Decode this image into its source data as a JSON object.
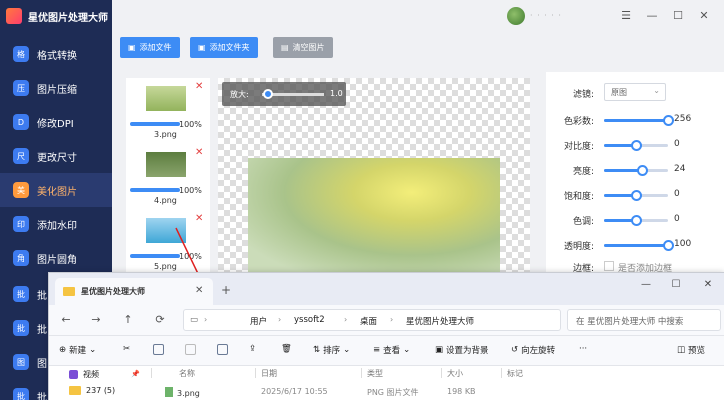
{
  "app": {
    "title": "星优图片处理大师",
    "user_name": "· · · · ·"
  },
  "sidebar": {
    "items": [
      {
        "label": "格式转换",
        "icon": "格"
      },
      {
        "label": "图片压缩",
        "icon": "压"
      },
      {
        "label": "修改DPI",
        "icon": "D"
      },
      {
        "label": "更改尺寸",
        "icon": "尺"
      },
      {
        "label": "美化图片",
        "icon": "美"
      },
      {
        "label": "添加水印",
        "icon": "印"
      },
      {
        "label": "图片圆角",
        "icon": "角"
      },
      {
        "label": "批",
        "icon": "批"
      },
      {
        "label": "批",
        "icon": "批"
      },
      {
        "label": "图",
        "icon": "图"
      },
      {
        "label": "批",
        "icon": "批"
      }
    ]
  },
  "toolbar": {
    "add_file": "添加文件",
    "add_folder": "添加文件夹",
    "clear": "清空图片"
  },
  "thumbnails": [
    {
      "name": "3.png",
      "progress": "100%"
    },
    {
      "name": "4.png",
      "progress": "100%"
    },
    {
      "name": "5.png",
      "progress": "100%"
    }
  ],
  "zoom": {
    "label": "放大:",
    "value": "1.0",
    "level": 0.1
  },
  "adjustments": {
    "filter_label": "滤镜:",
    "filter_value": "原图",
    "sliders": [
      {
        "label": "色彩数:",
        "value": "256",
        "level": 1.0
      },
      {
        "label": "对比度:",
        "value": "0",
        "level": 0.5
      },
      {
        "label": "亮度:",
        "value": "24",
        "level": 0.6
      },
      {
        "label": "饱和度:",
        "value": "0",
        "level": 0.5
      },
      {
        "label": "色调:",
        "value": "0",
        "level": 0.5
      },
      {
        "label": "透明度:",
        "value": "100",
        "level": 1.0
      }
    ],
    "border_label": "边框:",
    "border_option": "是否添加边框"
  },
  "explorer": {
    "tab_title": "星优图片处理大师",
    "breadcrumbs": [
      "用户",
      "yssoft2",
      "桌面",
      "星优图片处理大师"
    ],
    "search_placeholder": "在 星优图片处理大师 中搜索",
    "tools": {
      "new": "新建",
      "sort": "排序",
      "view": "查看",
      "set_wallpaper": "设置为背景",
      "rotate_left": "向左旋转",
      "more": "···",
      "preview": "预览"
    },
    "tree": [
      {
        "label": "视频"
      },
      {
        "label": "237 (5)"
      }
    ],
    "columns": [
      "名称",
      "日期",
      "类型",
      "大小",
      "标记"
    ],
    "files": [
      {
        "name": "3.png",
        "date": "2025/6/17 10:55",
        "type": "PNG 图片文件",
        "size": "198 KB"
      }
    ]
  },
  "colors": {
    "sidebar_bg": "#1e2c55",
    "accent": "#3d8cf5",
    "active_nav": "#ff9a3d"
  }
}
